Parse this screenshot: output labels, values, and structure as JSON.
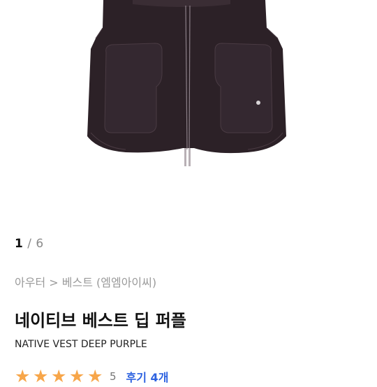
{
  "pager": {
    "current": "1",
    "separator": "/",
    "total": "6"
  },
  "breadcrumb": {
    "category": "아우터",
    "separator": ">",
    "subcategory": "베스트",
    "brand": "(엠엠아이씨)"
  },
  "product": {
    "title_ko": "네이티브 베스트 딥 퍼플",
    "title_en": "NATIVE VEST DEEP PURPLE"
  },
  "rating": {
    "stars": 5,
    "score": "5",
    "reviews_label": "후기 4개",
    "star_color": "#f7a64a"
  },
  "colors": {
    "vest": "#2c2127",
    "link": "#2d62e0"
  }
}
